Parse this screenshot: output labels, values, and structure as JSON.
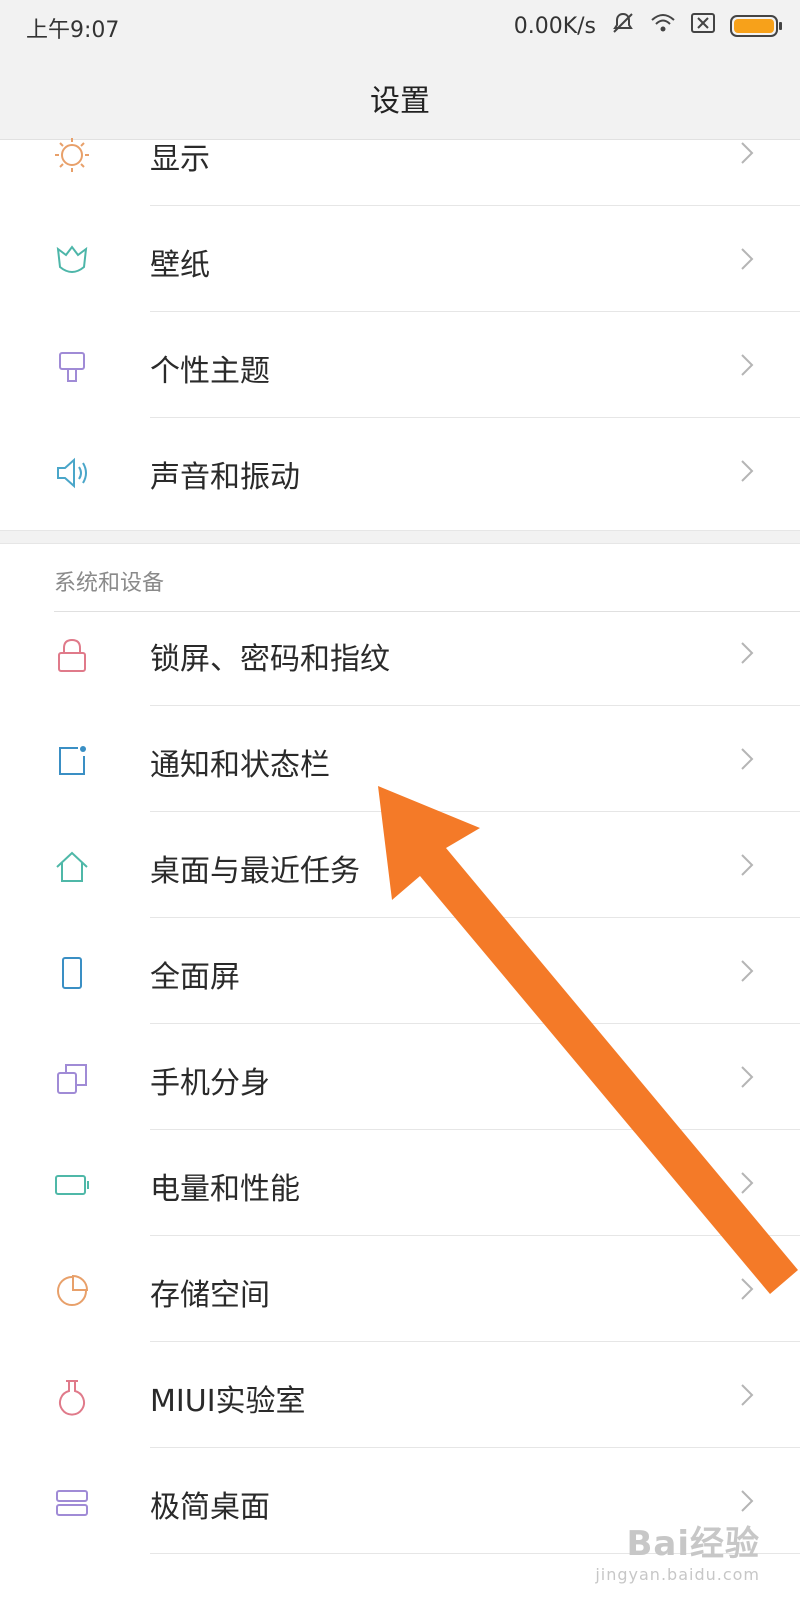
{
  "status_bar": {
    "time": "上午9:07",
    "network_speed": "0.00K/s",
    "icons": [
      "mute-icon",
      "wifi-icon",
      "no-sim-icon",
      "battery-icon"
    ],
    "battery_color": "#f7a11a"
  },
  "header": {
    "title": "设置"
  },
  "list_top": [
    {
      "label": "显示",
      "icon": "brightness-icon",
      "icon_color": "#e8a06a"
    },
    {
      "label": "壁纸",
      "icon": "wallpaper-tulip-icon",
      "icon_color": "#4db6a9"
    },
    {
      "label": "个性主题",
      "icon": "theme-brush-icon",
      "icon_color": "#a08bd6"
    },
    {
      "label": "声音和振动",
      "icon": "speaker-icon",
      "icon_color": "#4aa6c9"
    }
  ],
  "section": {
    "header": "系统和设备"
  },
  "list_system": [
    {
      "label": "锁屏、密码和指纹",
      "icon": "lock-icon",
      "icon_color": "#e07a8a"
    },
    {
      "label": "通知和状态栏",
      "icon": "notification-icon",
      "icon_color": "#3a8fc4"
    },
    {
      "label": "桌面与最近任务",
      "icon": "home-icon",
      "icon_color": "#4fb8a8"
    },
    {
      "label": "全面屏",
      "icon": "phone-screen-icon",
      "icon_color": "#3a8fc4"
    },
    {
      "label": "手机分身",
      "icon": "second-space-icon",
      "icon_color": "#a08bd6"
    },
    {
      "label": "电量和性能",
      "icon": "battery-outline-icon",
      "icon_color": "#4fb8a8"
    },
    {
      "label": "存储空间",
      "icon": "storage-pie-icon",
      "icon_color": "#e8a06a"
    },
    {
      "label": "MIUI实验室",
      "icon": "flask-icon",
      "icon_color": "#e07a8a"
    },
    {
      "label": "极简桌面",
      "icon": "simple-desktop-icon",
      "icon_color": "#a08bd6"
    }
  ],
  "annotation": {
    "arrow_color": "#f47a28"
  },
  "watermark": {
    "brand": "Bai经验",
    "url": "jingyan.baidu.com"
  }
}
